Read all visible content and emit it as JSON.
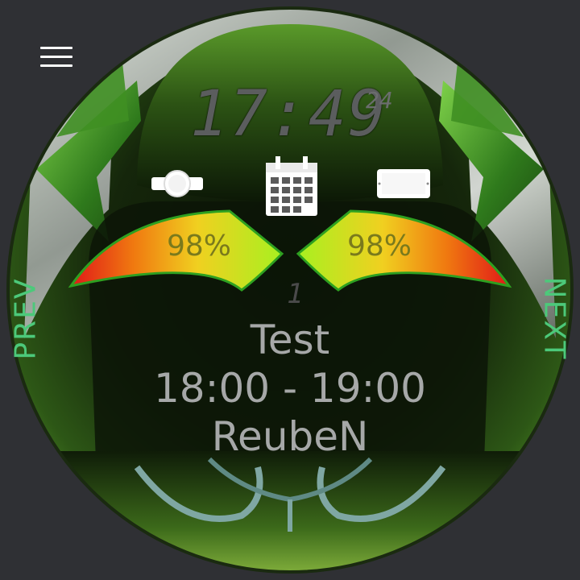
{
  "colors": {
    "background": "#2f3034",
    "dial_green": "#2f5a1a",
    "accent_green": "#4cc97a",
    "digit_gray": "#5b5d5e",
    "text_gray": "#a6a8a8"
  },
  "menu": {
    "icon": "hamburger-menu-icon"
  },
  "clock": {
    "time": "17:49",
    "seconds": "24"
  },
  "status_icons": {
    "watch_icon": "watch-icon",
    "calendar_icon": "calendar-icon",
    "phone_icon": "phone-icon"
  },
  "gauges": {
    "watch_battery": {
      "label": "98%",
      "value": 98
    },
    "phone_battery": {
      "label": "98%",
      "value": 98
    }
  },
  "event": {
    "index_glyph": "1",
    "title": "Test",
    "time_range": "18:00 - 19:00",
    "owner": "ReubeN"
  },
  "navigation": {
    "prev_label": "PREV",
    "next_label": "NEXT"
  }
}
